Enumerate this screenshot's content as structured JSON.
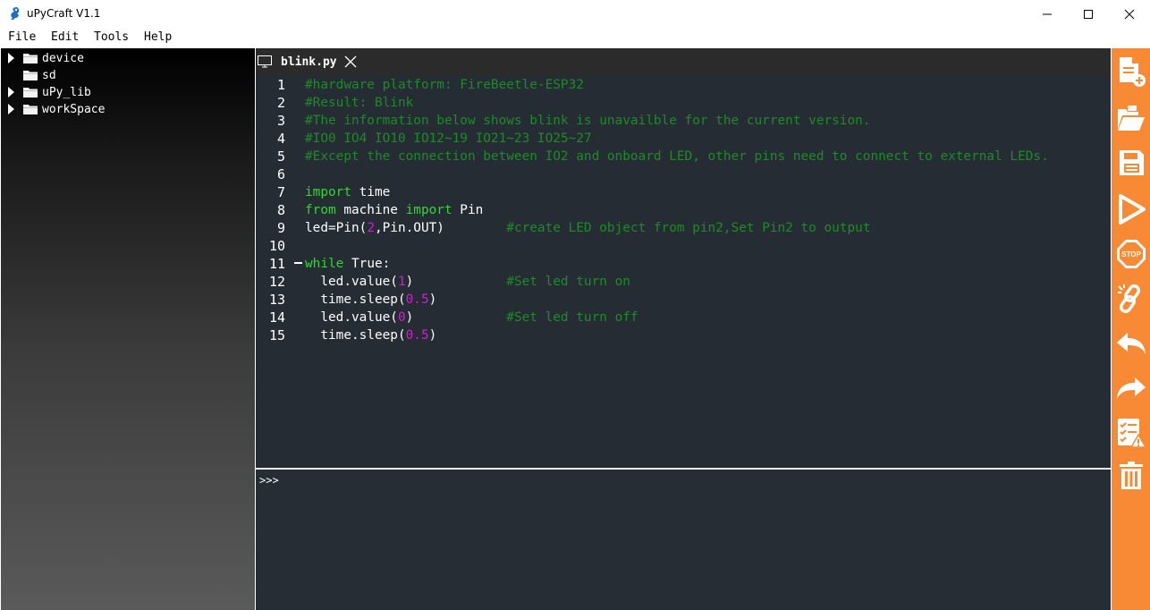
{
  "window": {
    "title": "uPyCraft V1.1"
  },
  "menu": {
    "items": [
      {
        "label": "File"
      },
      {
        "label": "Edit"
      },
      {
        "label": "Tools"
      },
      {
        "label": "Help"
      }
    ]
  },
  "tree": {
    "items": [
      {
        "label": "device",
        "expandable": true
      },
      {
        "label": "sd",
        "expandable": false
      },
      {
        "label": "uPy_lib",
        "expandable": true
      },
      {
        "label": "workSpace",
        "expandable": true
      }
    ]
  },
  "editor": {
    "tab": {
      "label": "blink.py"
    },
    "line_numbers": [
      "1",
      "2",
      "3",
      "4",
      "5",
      "6",
      "7",
      "8",
      "9",
      "10",
      "11",
      "12",
      "13",
      "14",
      "15"
    ],
    "lines": [
      [
        {
          "t": "#hardware platform: FireBeetle-ESP32",
          "c": "cm"
        }
      ],
      [
        {
          "t": "#Result: Blink",
          "c": "cm"
        }
      ],
      [
        {
          "t": "#The information below shows blink is unavailble for the current version.",
          "c": "cm"
        }
      ],
      [
        {
          "t": "#IO0 IO4 IO10 IO12~19 IO21~23 IO25~27",
          "c": "cm"
        }
      ],
      [
        {
          "t": "#Except the connection between IO2 and onboard LED, other pins need to connect to external LEDs.",
          "c": "cm"
        }
      ],
      [],
      [
        {
          "t": "import",
          "c": "kw"
        },
        {
          "t": " time",
          "c": ""
        }
      ],
      [
        {
          "t": "from",
          "c": "kw"
        },
        {
          "t": " machine ",
          "c": ""
        },
        {
          "t": "import",
          "c": "kw"
        },
        {
          "t": " Pin",
          "c": ""
        }
      ],
      [
        {
          "t": "led=Pin(",
          "c": ""
        },
        {
          "t": "2",
          "c": "num"
        },
        {
          "t": ",Pin.OUT)        ",
          "c": ""
        },
        {
          "t": "#create LED object from pin2,Set Pin2 to output",
          "c": "cm"
        }
      ],
      [],
      [
        {
          "t": "while",
          "c": "kw"
        },
        {
          "t": " True:",
          "c": ""
        }
      ],
      [
        {
          "t": "  led.value(",
          "c": ""
        },
        {
          "t": "1",
          "c": "num"
        },
        {
          "t": ")            ",
          "c": ""
        },
        {
          "t": "#Set led turn on",
          "c": "cm"
        }
      ],
      [
        {
          "t": "  time.sleep(",
          "c": ""
        },
        {
          "t": "0.5",
          "c": "num"
        },
        {
          "t": ")",
          "c": ""
        }
      ],
      [
        {
          "t": "  led.value(",
          "c": ""
        },
        {
          "t": "0",
          "c": "num"
        },
        {
          "t": ")            ",
          "c": ""
        },
        {
          "t": "#Set led turn off",
          "c": "cm"
        }
      ],
      [
        {
          "t": "  time.sleep(",
          "c": ""
        },
        {
          "t": "0.5",
          "c": "num"
        },
        {
          "t": ")",
          "c": ""
        }
      ]
    ]
  },
  "terminal": {
    "prompt": ">>>"
  },
  "toolbar": {
    "tools": [
      {
        "icon": "new-file-icon"
      },
      {
        "icon": "open-folder-icon"
      },
      {
        "icon": "save-icon"
      },
      {
        "icon": "download-run-icon"
      },
      {
        "icon": "stop-icon"
      },
      {
        "icon": "connect-icon"
      },
      {
        "icon": "undo-icon"
      },
      {
        "icon": "redo-icon"
      },
      {
        "icon": "syntax-check-icon"
      },
      {
        "icon": "clear-icon"
      }
    ],
    "colors": {
      "background": "#f98a35",
      "icon": "#ffffff"
    }
  },
  "colors": {
    "comment": "#1c8c25",
    "keyword": "#30d830",
    "number": "#d818d8",
    "editor_bg": "#252c34"
  }
}
